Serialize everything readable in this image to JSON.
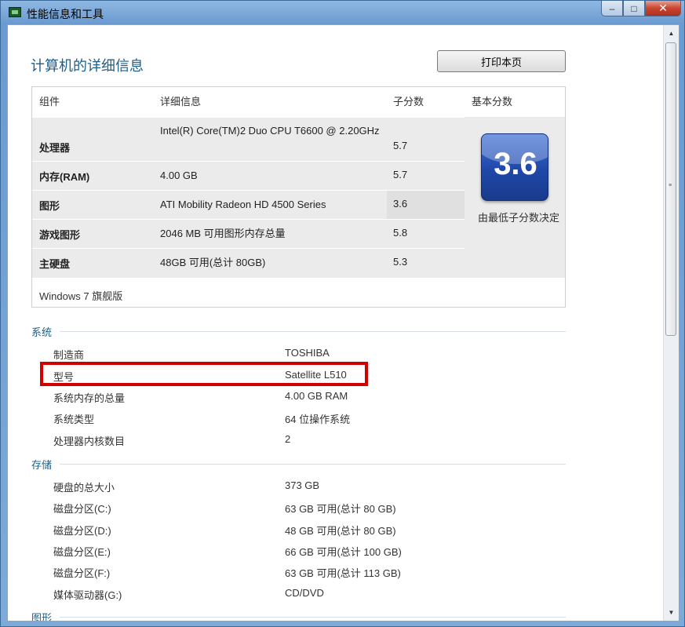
{
  "window": {
    "title": "性能信息和工具",
    "minimize": "–",
    "maximize": "□",
    "close": "✕"
  },
  "page": {
    "heading": "计算机的详细信息",
    "print_button": "打印本页"
  },
  "score_table": {
    "headers": {
      "component": "组件",
      "details": "详细信息",
      "subscore": "子分数",
      "base_score": "基本分数"
    },
    "rows": [
      {
        "component": "处理器",
        "details": "Intel(R) Core(TM)2 Duo CPU T6600 @ 2.20GHz",
        "subscore": "5.7"
      },
      {
        "component": "内存(RAM)",
        "details": "4.00 GB",
        "subscore": "5.7"
      },
      {
        "component": "图形",
        "details": "ATI Mobility Radeon HD 4500 Series",
        "subscore": "3.6"
      },
      {
        "component": "游戏图形",
        "details": "2046 MB 可用图形内存总量",
        "subscore": "5.8"
      },
      {
        "component": "主硬盘",
        "details": "48GB 可用(总计 80GB)",
        "subscore": "5.3"
      }
    ],
    "base_score": "3.6",
    "base_note": "由最低子分数决定",
    "edition": "Windows 7 旗舰版"
  },
  "system": {
    "title": "系统",
    "items": [
      {
        "label": "制造商",
        "value": "TOSHIBA"
      },
      {
        "label": "型号",
        "value": "Satellite L510"
      },
      {
        "label": "系统内存的总量",
        "value": "4.00 GB RAM"
      },
      {
        "label": "系统类型",
        "value": "64 位操作系统"
      },
      {
        "label": "处理器内核数目",
        "value": "2"
      }
    ]
  },
  "storage": {
    "title": "存储",
    "items": [
      {
        "label": "硬盘的总大小",
        "value": "373 GB"
      },
      {
        "label": "磁盘分区(C:)",
        "value": "63 GB 可用(总计 80 GB)"
      },
      {
        "label": "磁盘分区(D:)",
        "value": "48 GB 可用(总计 80 GB)"
      },
      {
        "label": "磁盘分区(E:)",
        "value": "66 GB 可用(总计 100 GB)"
      },
      {
        "label": "磁盘分区(F:)",
        "value": "63 GB 可用(总计 113 GB)"
      },
      {
        "label": "媒体驱动器(G:)",
        "value": "CD/DVD"
      }
    ]
  },
  "graphics": {
    "title": "图形"
  },
  "colors": {
    "accent": "#1f5e87",
    "highlight_box": "#d30000",
    "lowest_score_cell": "#e0e0e0"
  }
}
